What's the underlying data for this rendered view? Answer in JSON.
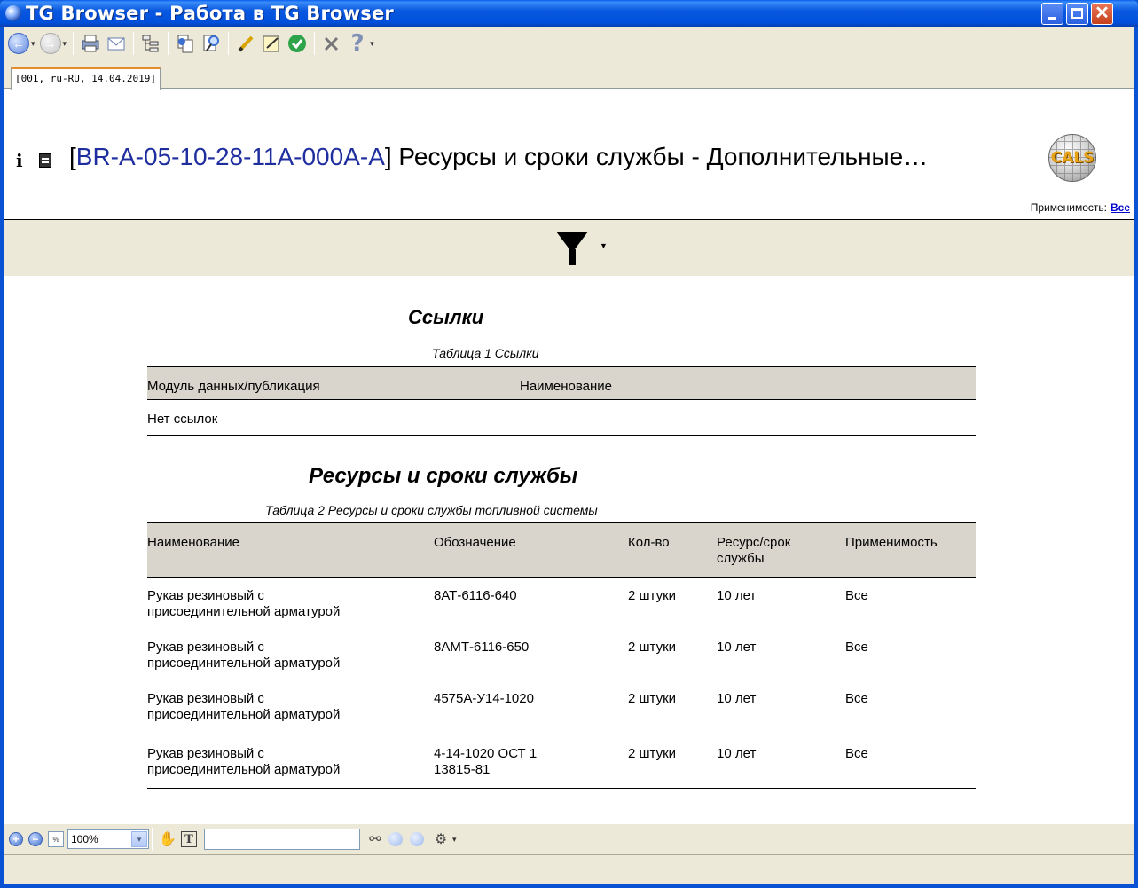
{
  "window": {
    "title": "TG Browser - Работа в TG Browser",
    "close_glyph": "✕"
  },
  "toolbar": {
    "icons": [
      "back-icon",
      "forward-icon",
      "print-icon",
      "email-icon",
      "tree-icon",
      "copy-icon",
      "find-icon",
      "annotate-icon",
      "note-icon",
      "check-icon",
      "tools-icon",
      "help-icon"
    ],
    "back_glyph": "←",
    "forward_glyph": "→",
    "help_glyph": "?"
  },
  "tab": {
    "label": "[001, ru-RU, 14.04.2019]"
  },
  "header": {
    "info_glyph": "i",
    "dm_code": "BR-A-05-10-28-11A-000A-A",
    "dm_open_bracket": "[",
    "dm_close_bracket": "]",
    "dm_title": " Ресурсы и сроки службы - Дополнительные…",
    "logo_text": "CALS",
    "applicability_label": "Применимость:",
    "applicability_value": "Все"
  },
  "sections": {
    "refs_title": "Ссылки",
    "refs_caption": "Таблица 1   Ссылки",
    "refs_columns": [
      "Модуль данных/публикация",
      "Наименование"
    ],
    "refs_empty": "Нет ссылок",
    "res_title": "Ресурсы и сроки службы",
    "res_caption": "Таблица 2   Ресурсы и сроки службы топливной системы",
    "res_columns": [
      "Наименование",
      "Обозначение",
      "Кол-во",
      "Ресурс/срок\nслужбы",
      "Применимость"
    ],
    "res_rows": [
      [
        "Рукав резиновый с\nприсоединительной арматурой",
        "8АТ-6116-640",
        "2 штуки",
        "10 лет",
        "Все"
      ],
      [
        "Рукав резиновый с\nприсоединительной арматурой",
        "8АМТ-6116-650",
        "2 штуки",
        "10 лет",
        "Все"
      ],
      [
        "Рукав резиновый с\nприсоединительной арматурой",
        "4575А-У14-1020",
        "2 штуки",
        "10 лет",
        "Все"
      ],
      [
        "Рукав резиновый с\nприсоединительной арматурой",
        "4-14-1020 ОСТ 1\n13815-81",
        "2 штуки",
        "10 лет",
        "Все"
      ]
    ]
  },
  "bottombar": {
    "zoom_value": "100%",
    "zoom_in_glyph": "+",
    "zoom_out_glyph": "−",
    "find_value": "",
    "hand_glyph": "✋",
    "text_glyph": "T",
    "binoculars_glyph": "⚯",
    "settings_glyph": "⚙",
    "dropdown_glyph": "▾"
  }
}
